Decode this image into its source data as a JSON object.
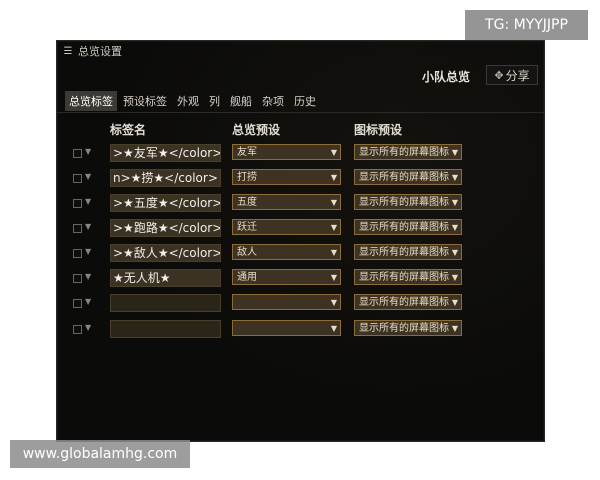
{
  "window": {
    "title": "总览设置",
    "squad_overview_label": "小队总览",
    "share_label": "分享"
  },
  "tabs": [
    {
      "label": "总览标签",
      "active": true
    },
    {
      "label": "预设标签",
      "active": false
    },
    {
      "label": "外观",
      "active": false
    },
    {
      "label": "列",
      "active": false
    },
    {
      "label": "舰船",
      "active": false
    },
    {
      "label": "杂项",
      "active": false
    },
    {
      "label": "历史",
      "active": false
    }
  ],
  "columns": {
    "label_name": "标签名",
    "overview_preset": "总览预设",
    "icon_preset": "图标预设"
  },
  "rows": [
    {
      "name": ">★友军★</color>",
      "preset": "友军",
      "icon": "显示所有的屏幕图标"
    },
    {
      "name": "n>★捞★</color>",
      "preset": "打捞",
      "icon": "显示所有的屏幕图标"
    },
    {
      "name": ">★五度★</color>",
      "preset": "五度",
      "icon": "显示所有的屏幕图标"
    },
    {
      "name": ">★跑路★</color>",
      "preset": "跃迁",
      "icon": "显示所有的屏幕图标"
    },
    {
      "name": ">★敌人★</color>",
      "preset": "敌人",
      "icon": "显示所有的屏幕图标"
    },
    {
      "name": " ★无人机★",
      "preset": "通用",
      "icon": "显示所有的屏幕图标"
    },
    {
      "name": "",
      "preset": "",
      "icon": "显示所有的屏幕图标"
    },
    {
      "name": "",
      "preset": "",
      "icon": "显示所有的屏幕图标"
    }
  ],
  "watermarks": {
    "tg": "TG: MYYJJPP",
    "site": "www.globalamhg.com"
  },
  "colors": {
    "window_bg": "#0b0b0a",
    "select_border": "#8a6d3a",
    "active_tab": "#3d3a35"
  }
}
